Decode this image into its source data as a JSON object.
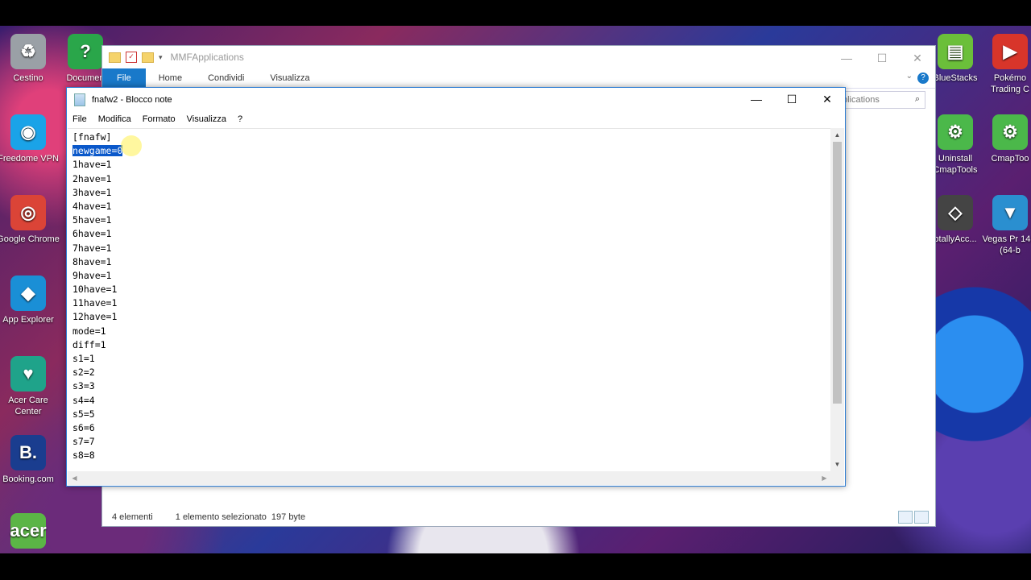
{
  "desktop": {
    "icons_left": [
      {
        "label": "Cestino",
        "icon": "recycle-bin-icon",
        "color": "#9aa0a6",
        "glyph": "♻"
      },
      {
        "label": "Documen",
        "icon": "help-document-icon",
        "color": "#2aa64a",
        "glyph": "?"
      },
      {
        "label": "Freedome VPN",
        "icon": "wifi-shield-icon",
        "color": "#1aa3e8",
        "glyph": "◉"
      },
      {
        "label": "Google Chrome",
        "icon": "chrome-icon",
        "color": "#db4437",
        "glyph": "◎"
      },
      {
        "label": "App Explorer",
        "icon": "app-explorer-icon",
        "color": "#1a8fd6",
        "glyph": "◆"
      },
      {
        "label": "Acer Care Center",
        "icon": "acer-care-icon",
        "color": "#1fa38a",
        "glyph": "♥"
      },
      {
        "label": "Booking.com",
        "icon": "booking-icon",
        "color": "#1a3d8f",
        "glyph": "B."
      },
      {
        "label": "",
        "icon": "acer-bag-icon",
        "color": "#5bb546",
        "glyph": "acer"
      }
    ],
    "icons_right": [
      {
        "label": "BlueStacks",
        "icon": "bluestacks-icon",
        "color": "#6bbf3a",
        "glyph": "▤"
      },
      {
        "label": "Pokémo Trading C",
        "icon": "pokemon-tcg-icon",
        "color": "#d8352a",
        "glyph": "▶"
      },
      {
        "label": "Uninstall CmapTools",
        "icon": "cmaptools-uninstall-icon",
        "color": "#4bb84a",
        "glyph": "⚙"
      },
      {
        "label": "CmapToo",
        "icon": "cmaptools-icon",
        "color": "#4bb84a",
        "glyph": "⚙"
      },
      {
        "label": "otallyAcc...",
        "icon": "unity-icon",
        "color": "#444",
        "glyph": "◇"
      },
      {
        "label": "Vegas Pr 14.0 (64-b",
        "icon": "vegas-pro-icon",
        "color": "#2a8fd0",
        "glyph": "▼"
      }
    ]
  },
  "explorer": {
    "title": "MMFApplications",
    "tabs": [
      "File",
      "Home",
      "Condividi",
      "Visualizza"
    ],
    "search_text": "plications",
    "status": {
      "count": "4 elementi",
      "selected": "1 elemento selezionato",
      "size": "197 byte"
    }
  },
  "notepad": {
    "title": "fnafw2 - Blocco note",
    "menu": [
      "File",
      "Modifica",
      "Formato",
      "Visualizza",
      "?"
    ],
    "lines": [
      "[fnafw]",
      "newgame=0",
      "1have=1",
      "2have=1",
      "3have=1",
      "4have=1",
      "5have=1",
      "6have=1",
      "7have=1",
      "8have=1",
      "9have=1",
      "10have=1",
      "11have=1",
      "12have=1",
      "mode=1",
      "diff=1",
      "s1=1",
      "s2=2",
      "s3=3",
      "s4=4",
      "s5=5",
      "s6=6",
      "s7=7",
      "s8=8"
    ],
    "selected_line_index": 1
  },
  "colors": {
    "accent": "#1979ca",
    "selection": "#0a58ca"
  }
}
